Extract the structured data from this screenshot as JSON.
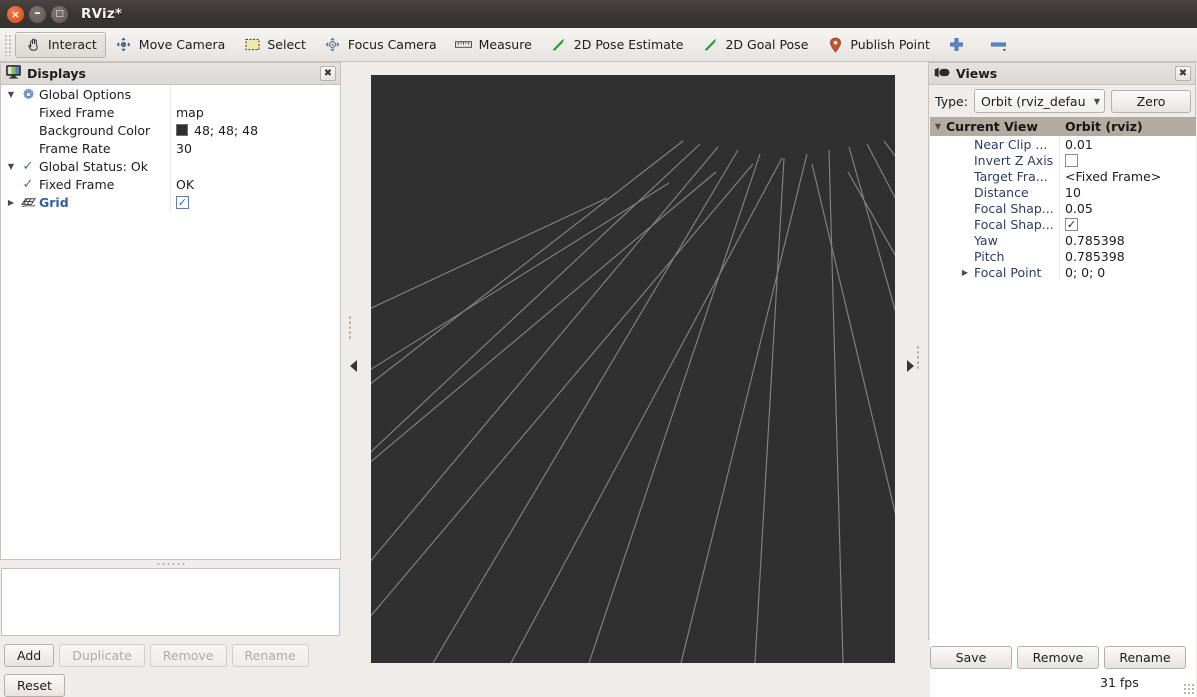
{
  "window": {
    "title": "RViz*",
    "buttons": {
      "close": "×",
      "minimize": "–",
      "maximize": "□"
    }
  },
  "toolbar": {
    "items": [
      {
        "label": "Interact",
        "icon": "hand-cursor-icon",
        "active": true
      },
      {
        "label": "Move Camera",
        "icon": "move-camera-icon",
        "active": false
      },
      {
        "label": "Select",
        "icon": "select-rect-icon",
        "active": false
      },
      {
        "label": "Focus Camera",
        "icon": "focus-camera-icon",
        "active": false
      },
      {
        "label": "Measure",
        "icon": "ruler-icon",
        "active": false
      },
      {
        "label": "2D Pose Estimate",
        "icon": "green-arrow-icon",
        "active": false
      },
      {
        "label": "2D Goal Pose",
        "icon": "green-arrow-icon",
        "active": false
      },
      {
        "label": "Publish Point",
        "icon": "map-pin-icon",
        "active": false
      },
      {
        "label": "",
        "icon": "plus-icon",
        "active": false
      },
      {
        "label": "",
        "icon": "minus-icon",
        "active": false
      }
    ]
  },
  "displays": {
    "title": "Displays",
    "close_label": "✖",
    "rows": [
      {
        "expander": "down",
        "icon": "gear-icon",
        "label": "Global Options",
        "indent": 0,
        "value_kind": "none",
        "value": ""
      },
      {
        "expander": "none",
        "icon": "none",
        "label": "Fixed Frame",
        "indent": 1,
        "value_kind": "text",
        "value": "map"
      },
      {
        "expander": "none",
        "icon": "none",
        "label": "Background Color",
        "indent": 1,
        "value_kind": "swatch",
        "value": "48; 48; 48",
        "color": "#303030"
      },
      {
        "expander": "none",
        "icon": "none",
        "label": "Frame Rate",
        "indent": 1,
        "value_kind": "text",
        "value": "30"
      },
      {
        "expander": "down",
        "icon": "check-icon",
        "label": "Global Status: Ok",
        "indent": 0,
        "value_kind": "none",
        "value": ""
      },
      {
        "expander": "none",
        "icon": "check-icon",
        "label": "Fixed Frame",
        "indent": 1,
        "value_kind": "text",
        "value": "OK"
      },
      {
        "expander": "right",
        "icon": "grid-icon",
        "label": "Grid",
        "indent": 0,
        "value_kind": "checkbox",
        "value": "✓",
        "link": true
      }
    ],
    "buttons": [
      {
        "label": "Add",
        "enabled": true
      },
      {
        "label": "Duplicate",
        "enabled": false
      },
      {
        "label": "Remove",
        "enabled": false
      },
      {
        "label": "Rename",
        "enabled": false
      }
    ],
    "reset_label": "Reset"
  },
  "views": {
    "title": "Views",
    "close_label": "✖",
    "type_label": "Type:",
    "type_value": "Orbit (rviz_defau",
    "zero_label": "Zero",
    "header": {
      "col1": "Current View",
      "col2": "Orbit (rviz)"
    },
    "rows": [
      {
        "label": "Near Clip ...",
        "value": "0.01",
        "kind": "text",
        "expander": "none"
      },
      {
        "label": "Invert Z Axis",
        "value": "",
        "kind": "checkbox-empty",
        "expander": "none"
      },
      {
        "label": "Target Fra...",
        "value": "<Fixed Frame>",
        "kind": "text",
        "expander": "none"
      },
      {
        "label": "Distance",
        "value": "10",
        "kind": "text",
        "expander": "none"
      },
      {
        "label": "Focal Shap...",
        "value": "0.05",
        "kind": "text",
        "expander": "none"
      },
      {
        "label": "Focal Shap...",
        "value": "✓",
        "kind": "checkbox",
        "expander": "none"
      },
      {
        "label": "Yaw",
        "value": "0.785398",
        "kind": "text",
        "expander": "none"
      },
      {
        "label": "Pitch",
        "value": "0.785398",
        "kind": "text",
        "expander": "none"
      },
      {
        "label": "Focal Point",
        "value": "0; 0; 0",
        "kind": "text",
        "expander": "right"
      }
    ],
    "buttons": [
      {
        "label": "Save",
        "enabled": true
      },
      {
        "label": "Remove",
        "enabled": true
      },
      {
        "label": "Rename",
        "enabled": true
      }
    ]
  },
  "viewport": {
    "background_color": "#303030",
    "grid_color": "#9a9a9a",
    "status": "31 fps"
  },
  "splitters": {
    "left_collapse": "collapse-left-arrow",
    "right_collapse": "collapse-right-arrow"
  }
}
